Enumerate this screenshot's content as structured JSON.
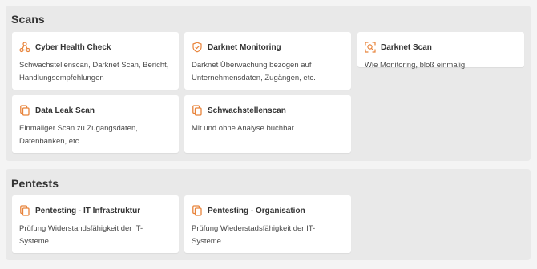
{
  "colors": {
    "accent": "#e8833a",
    "section_bg": "#e9e9e9",
    "card_bg": "#ffffff"
  },
  "sections": [
    {
      "title": "Scans",
      "cards": [
        {
          "title": "Cyber Health Check",
          "desc": "Schwachstellenscan, Darknet Scan, Bericht, Handlungsempfehlungen",
          "icon": "nodes-icon"
        },
        {
          "title": "Darknet Monitoring",
          "desc": "Darknet Überwachung bezogen auf Unternehmensdaten, Zugängen, etc.",
          "icon": "shield-check-icon"
        },
        {
          "title": "Darknet Scan",
          "desc": "Wie Monitoring, bloß einmalig",
          "icon": "scan-search-icon"
        },
        {
          "title": "Data Leak Scan",
          "desc": "Einmaliger Scan zu Zugangsdaten, Datenbanken, etc.",
          "icon": "copy-icon"
        },
        {
          "title": "Schwachstellenscan",
          "desc": "Mit und ohne Analyse buchbar",
          "icon": "copy-icon"
        }
      ]
    },
    {
      "title": "Pentests",
      "cards": [
        {
          "title": "Pentesting - IT Infrastruktur",
          "desc": "Prüfung Widerstandsfähigkeit der IT-Systeme",
          "icon": "copy-icon"
        },
        {
          "title": "Pentesting - Organisation",
          "desc": "Prüfung Wiederstadsfähigkeit der IT-Systeme",
          "icon": "copy-icon"
        }
      ]
    }
  ]
}
